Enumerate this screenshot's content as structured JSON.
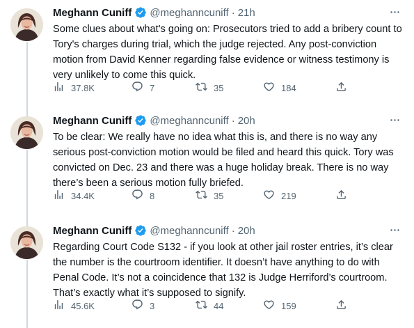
{
  "tweets": [
    {
      "author_name": "Meghann Cuniff",
      "handle": "@meghanncuniff",
      "separator": "·",
      "time": "21h",
      "text": "Some clues about what's going on: Prosecutors tried to add a bribery count to Tory's charges during trial, which the judge rejected. Any post-conviction motion from David Kenner regarding false evidence or witness testimony is very unlikely to come this quick.",
      "views": "37.8K",
      "replies": "7",
      "retweets": "35",
      "likes": "184"
    },
    {
      "author_name": "Meghann Cuniff",
      "handle": "@meghanncuniff",
      "separator": "·",
      "time": "20h",
      "text": "To be clear: We really have no idea what this is, and there is no way any serious post-conviction motion would be filed and heard this quick. Tory was convicted on Dec. 23 and there was a huge holiday break. There is no way there’s been a serious motion fully briefed.",
      "views": "34.4K",
      "replies": "8",
      "retweets": "35",
      "likes": "219"
    },
    {
      "author_name": "Meghann Cuniff",
      "handle": "@meghanncuniff",
      "separator": "·",
      "time": "20h",
      "text": "Regarding Court Code S132 - if you look at other jail roster entries, it’s clear the number is the courtroom identifier. It doesn’t have anything to do with Penal Code. It’s not a coincidence that 132 is Judge Herriford’s courtroom. That’s exactly what it’s supposed to signify.",
      "views": "45.6K",
      "replies": "3",
      "retweets": "44",
      "likes": "159"
    }
  ],
  "colors": {
    "text": "#0f1419",
    "secondary": "#536471",
    "verified": "#1d9bf0",
    "thread_line": "#cfd9de"
  },
  "icons": [
    "verified-badge-icon",
    "more-icon",
    "views-icon",
    "reply-icon",
    "retweet-icon",
    "like-icon",
    "share-icon"
  ]
}
